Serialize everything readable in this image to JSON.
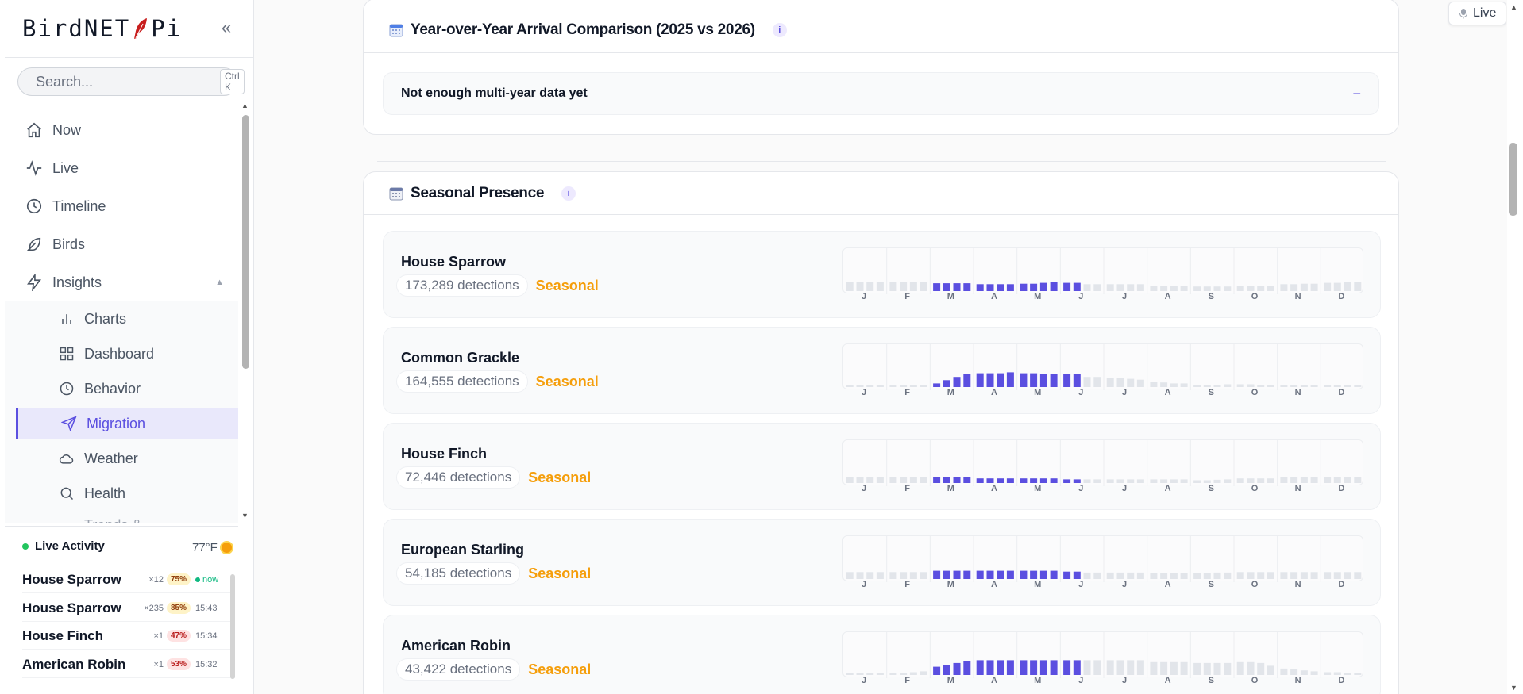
{
  "sidebar": {
    "brand_left": "BirdNET",
    "brand_right": "Pi",
    "collapse_label": "«",
    "search": {
      "placeholder": "Search...",
      "shortcut": "Ctrl K"
    },
    "nav": [
      {
        "label": "Now",
        "icon": "home-icon"
      },
      {
        "label": "Live",
        "icon": "activity-icon"
      },
      {
        "label": "Timeline",
        "icon": "clock-icon"
      },
      {
        "label": "Birds",
        "icon": "feather-icon"
      },
      {
        "label": "Insights",
        "icon": "zap-icon"
      }
    ],
    "insights_caret": "▲",
    "subnav": [
      {
        "label": "Charts",
        "icon": "bar-chart-icon"
      },
      {
        "label": "Dashboard",
        "icon": "grid-icon"
      },
      {
        "label": "Behavior",
        "icon": "clock-icon"
      },
      {
        "label": "Migration",
        "icon": "send-icon",
        "active": true
      },
      {
        "label": "Weather",
        "icon": "cloud-icon"
      },
      {
        "label": "Health",
        "icon": "search-icon"
      },
      {
        "label": "Trends &",
        "icon": ""
      }
    ],
    "live_activity": {
      "title": "Live Activity",
      "temperature": "77°F",
      "items": [
        {
          "name": "House Sparrow",
          "count": "×12",
          "confidence": "75%",
          "time": "now"
        },
        {
          "name": "House Sparrow",
          "count": "×235",
          "confidence": "85%",
          "time": "15:43"
        },
        {
          "name": "House Finch",
          "count": "×1",
          "confidence": "47%",
          "time": "15:34"
        },
        {
          "name": "American Robin",
          "count": "×1",
          "confidence": "53%",
          "time": "15:32"
        }
      ]
    }
  },
  "live_chip": {
    "label": "Live"
  },
  "yoy_card": {
    "title": "Year-over-Year Arrival Comparison (2025 vs 2026)",
    "info": "i",
    "accordion_label": "Not enough multi-year data yet",
    "accordion_toggle": "−"
  },
  "seasonal_card": {
    "title": "Seasonal Presence",
    "info": "i",
    "months": [
      "J",
      "F",
      "M",
      "A",
      "M",
      "J",
      "J",
      "A",
      "S",
      "O",
      "N",
      "D"
    ],
    "colors": {
      "active": "#5b4fe0",
      "inactive": "#e2e5ea"
    },
    "species": [
      {
        "name": "House Sparrow",
        "detections": "173,289 detections",
        "status": "Seasonal",
        "bars": [
          0.2,
          0.2,
          0.2,
          0.2,
          0.2,
          0.2,
          0.2,
          0.2,
          0.17,
          0.17,
          0.17,
          0.17,
          0.15,
          0.15,
          0.15,
          0.15,
          0.16,
          0.16,
          0.18,
          0.19,
          0.18,
          0.18,
          0.15,
          0.15,
          0.15,
          0.15,
          0.15,
          0.15,
          0.12,
          0.12,
          0.12,
          0.12,
          0.1,
          0.1,
          0.1,
          0.1,
          0.12,
          0.12,
          0.12,
          0.12,
          0.15,
          0.15,
          0.16,
          0.16,
          0.18,
          0.18,
          0.2,
          0.2
        ],
        "active": [
          0,
          0,
          0,
          0,
          0,
          0,
          0,
          0,
          1,
          1,
          1,
          1,
          1,
          1,
          1,
          1,
          1,
          1,
          1,
          1,
          1,
          1,
          0,
          0,
          0,
          0,
          0,
          0,
          0,
          0,
          0,
          0,
          0,
          0,
          0,
          0,
          0,
          0,
          0,
          0,
          0,
          0,
          0,
          0,
          0,
          0,
          0,
          0
        ]
      },
      {
        "name": "Common Grackle",
        "detections": "164,555 detections",
        "status": "Seasonal",
        "bars": [
          0.05,
          0.05,
          0.05,
          0.05,
          0.05,
          0.05,
          0.05,
          0.05,
          0.08,
          0.15,
          0.22,
          0.28,
          0.3,
          0.3,
          0.3,
          0.32,
          0.3,
          0.3,
          0.28,
          0.28,
          0.28,
          0.28,
          0.22,
          0.22,
          0.2,
          0.2,
          0.18,
          0.16,
          0.12,
          0.1,
          0.08,
          0.08,
          0.05,
          0.05,
          0.05,
          0.06,
          0.06,
          0.06,
          0.05,
          0.05,
          0.05,
          0.05,
          0.05,
          0.05,
          0.05,
          0.05,
          0.05,
          0.05
        ],
        "active": [
          0,
          0,
          0,
          0,
          0,
          0,
          0,
          0,
          1,
          1,
          1,
          1,
          1,
          1,
          1,
          1,
          1,
          1,
          1,
          1,
          1,
          1,
          0,
          0,
          0,
          0,
          0,
          0,
          0,
          0,
          0,
          0,
          0,
          0,
          0,
          0,
          0,
          0,
          0,
          0,
          0,
          0,
          0,
          0,
          0,
          0,
          0,
          0
        ]
      },
      {
        "name": "House Finch",
        "detections": "72,446 detections",
        "status": "Seasonal",
        "bars": [
          0.12,
          0.12,
          0.12,
          0.12,
          0.12,
          0.12,
          0.12,
          0.12,
          0.12,
          0.12,
          0.12,
          0.12,
          0.1,
          0.1,
          0.1,
          0.1,
          0.1,
          0.1,
          0.1,
          0.1,
          0.08,
          0.08,
          0.08,
          0.08,
          0.08,
          0.08,
          0.08,
          0.08,
          0.08,
          0.08,
          0.08,
          0.08,
          0.06,
          0.06,
          0.07,
          0.08,
          0.1,
          0.1,
          0.1,
          0.1,
          0.12,
          0.12,
          0.12,
          0.12,
          0.12,
          0.12,
          0.12,
          0.12
        ],
        "active": [
          0,
          0,
          0,
          0,
          0,
          0,
          0,
          0,
          1,
          1,
          1,
          1,
          1,
          1,
          1,
          1,
          1,
          1,
          1,
          1,
          1,
          1,
          0,
          0,
          0,
          0,
          0,
          0,
          0,
          0,
          0,
          0,
          0,
          0,
          0,
          0,
          0,
          0,
          0,
          0,
          0,
          0,
          0,
          0,
          0,
          0,
          0,
          0
        ]
      },
      {
        "name": "European Starling",
        "detections": "54,185 detections",
        "status": "Seasonal",
        "bars": [
          0.15,
          0.15,
          0.15,
          0.15,
          0.15,
          0.15,
          0.15,
          0.15,
          0.18,
          0.18,
          0.18,
          0.18,
          0.18,
          0.18,
          0.18,
          0.18,
          0.18,
          0.18,
          0.18,
          0.18,
          0.16,
          0.16,
          0.14,
          0.14,
          0.14,
          0.14,
          0.14,
          0.14,
          0.12,
          0.12,
          0.12,
          0.12,
          0.12,
          0.12,
          0.14,
          0.14,
          0.15,
          0.15,
          0.15,
          0.15,
          0.15,
          0.15,
          0.15,
          0.15,
          0.15,
          0.15,
          0.15,
          0.15
        ],
        "active": [
          0,
          0,
          0,
          0,
          0,
          0,
          0,
          0,
          1,
          1,
          1,
          1,
          1,
          1,
          1,
          1,
          1,
          1,
          1,
          1,
          1,
          1,
          0,
          0,
          0,
          0,
          0,
          0,
          0,
          0,
          0,
          0,
          0,
          0,
          0,
          0,
          0,
          0,
          0,
          0,
          0,
          0,
          0,
          0,
          0,
          0,
          0,
          0
        ]
      },
      {
        "name": "American Robin",
        "detections": "43,422 detections",
        "status": "Seasonal",
        "bars": [
          0.04,
          0.04,
          0.04,
          0.04,
          0.04,
          0.05,
          0.06,
          0.08,
          0.18,
          0.22,
          0.26,
          0.3,
          0.32,
          0.32,
          0.32,
          0.32,
          0.32,
          0.32,
          0.32,
          0.32,
          0.32,
          0.32,
          0.32,
          0.32,
          0.32,
          0.32,
          0.32,
          0.32,
          0.28,
          0.28,
          0.28,
          0.28,
          0.26,
          0.26,
          0.26,
          0.26,
          0.28,
          0.28,
          0.26,
          0.2,
          0.14,
          0.12,
          0.1,
          0.08,
          0.06,
          0.06,
          0.05,
          0.05
        ],
        "active": [
          0,
          0,
          0,
          0,
          0,
          0,
          0,
          0,
          1,
          1,
          1,
          1,
          1,
          1,
          1,
          1,
          1,
          1,
          1,
          1,
          1,
          1,
          0,
          0,
          0,
          0,
          0,
          0,
          0,
          0,
          0,
          0,
          0,
          0,
          0,
          0,
          0,
          0,
          0,
          0,
          0,
          0,
          0,
          0,
          0,
          0,
          0,
          0
        ]
      }
    ]
  }
}
